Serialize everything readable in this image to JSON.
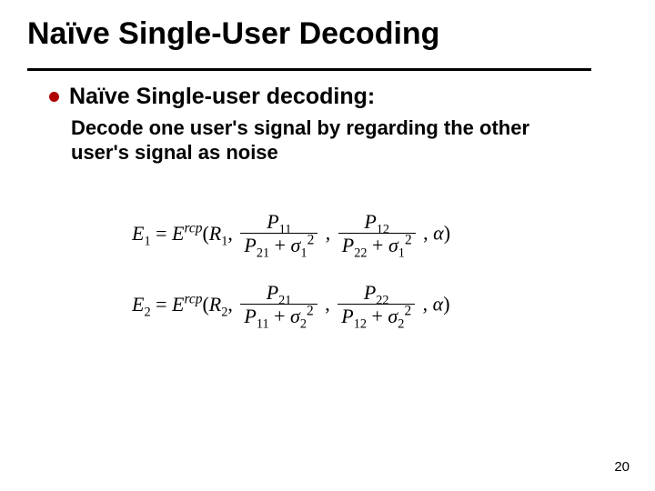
{
  "title": "Naïve Single-User Decoding",
  "bullet": {
    "heading": "Naïve Single-user decoding:"
  },
  "body": "Decode one user's signal by regarding the other user's signal as noise",
  "eq1": {
    "lhs_var": "E",
    "lhs_sub": "1",
    "func_base": "E",
    "func_sup": "rcp",
    "arg0_var": "R",
    "arg0_sub": "1",
    "f1": {
      "num_var": "P",
      "num_sub": "11",
      "den_l_var": "P",
      "den_l_sub": "21",
      "den_r_var": "σ",
      "den_r_sub": "1"
    },
    "f2": {
      "num_var": "P",
      "num_sub": "12",
      "den_l_var": "P",
      "den_l_sub": "22",
      "den_r_var": "σ",
      "den_r_sub": "1"
    },
    "tail_var": "α"
  },
  "eq2": {
    "lhs_var": "E",
    "lhs_sub": "2",
    "func_base": "E",
    "func_sup": "rcp",
    "arg0_var": "R",
    "arg0_sub": "2",
    "f1": {
      "num_var": "P",
      "num_sub": "21",
      "den_l_var": "P",
      "den_l_sub": "11",
      "den_r_var": "σ",
      "den_r_sub": "2"
    },
    "f2": {
      "num_var": "P",
      "num_sub": "22",
      "den_l_var": "P",
      "den_l_sub": "12",
      "den_r_var": "σ",
      "den_r_sub": "2"
    },
    "tail_var": "α"
  },
  "page_number": "20"
}
